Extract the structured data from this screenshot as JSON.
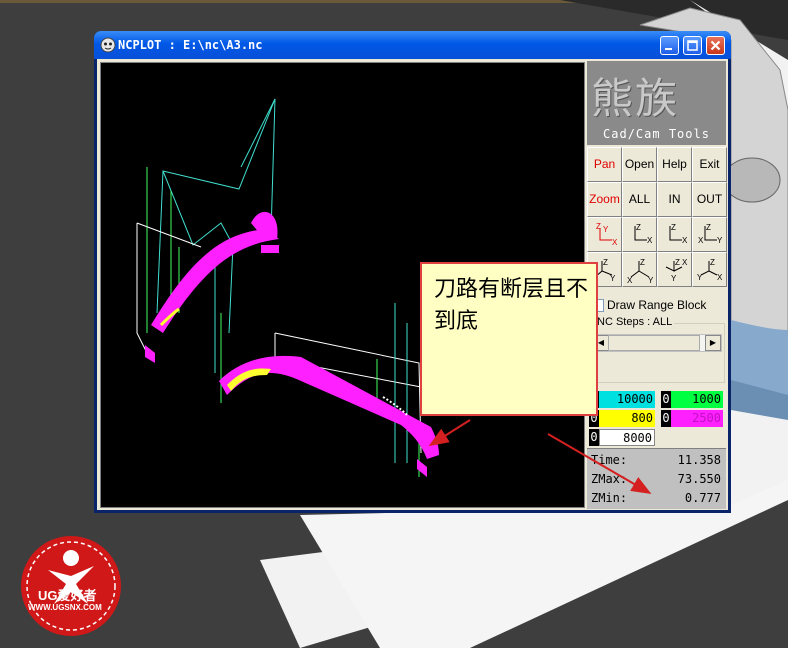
{
  "window": {
    "title": "NCPLOT : E:\\nc\\A3.nc",
    "icon": "app-icon",
    "controls": [
      "minimize-icon",
      "maximize-icon",
      "close-icon"
    ]
  },
  "logo": {
    "chinese": "熊族",
    "english": "Cad/Cam Tools"
  },
  "toolbar": {
    "row1": [
      "Pan",
      "Open",
      "Help",
      "Exit"
    ],
    "row2": [
      "Zoom",
      "ALL",
      "IN",
      "OUT"
    ],
    "view_icons": [
      "view-xy-icon",
      "view-xz-icon",
      "view-xz2-icon",
      "view-yz-icon",
      "iso-view-1-icon",
      "iso-view-2-icon",
      "iso-view-3-icon",
      "iso-view-4-icon"
    ],
    "accent_red": "#e00000"
  },
  "options": {
    "draw_range_block": "Draw Range Block",
    "nc_steps_label": "NC Steps : ALL"
  },
  "feed_colors": [
    {
      "index": "0",
      "value": "10000",
      "color": "#00e0e0"
    },
    {
      "index": "0",
      "value": "1000",
      "color": "#00ff40"
    },
    {
      "index": "0",
      "value": "800",
      "color": "#ffff00"
    },
    {
      "index": "0",
      "value": "2500",
      "color": "#ff20ff"
    },
    {
      "index": "0",
      "value": "8000",
      "color": "#ffffff"
    }
  ],
  "stats": {
    "time_label": "Time:",
    "time_value": "11.358",
    "zmax_label": "ZMax:",
    "zmax_value": "73.550",
    "zmin_label": "ZMin:",
    "zmin_value": "0.777"
  },
  "annotation": {
    "text": "刀路有断层且不到底",
    "border_color": "#e04040",
    "fill": "#ffffc4"
  },
  "watermark": {
    "brand": "UG爱好者",
    "url": "WWW.UGSNX.COM"
  }
}
